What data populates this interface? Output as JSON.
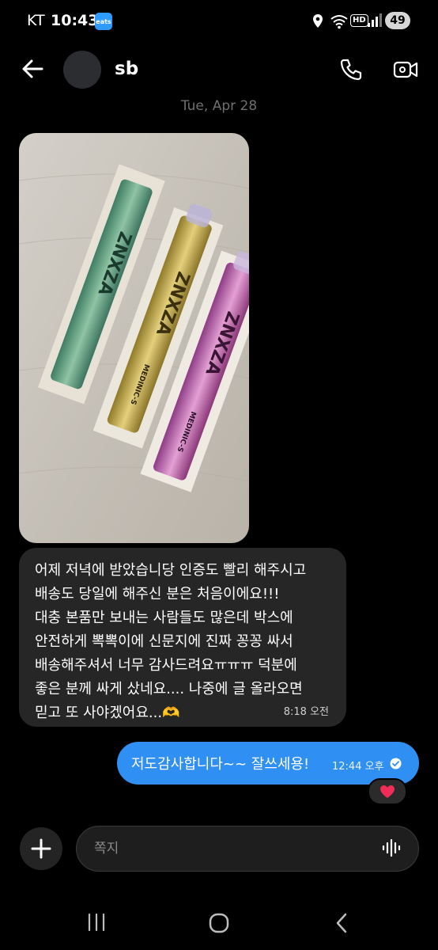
{
  "status_bar": {
    "carrier": "KT",
    "time": "10:43",
    "app_badge": "eats",
    "hd_label": "HD",
    "battery": "49"
  },
  "header": {
    "contact_name": "sb"
  },
  "date_separator": "Tue, Apr 28",
  "messages": {
    "received": {
      "lines": [
        "어제 저녁에 받았습니당 인증도 빨리 해주시고",
        "배송도 당일에 해주신 분은 처음이에요!!!",
        "대충 본품만 보내는 사람들도 많은데 박스에",
        "안전하게 뽁뽁이에 신문지에 진짜 꽁꽁 싸서",
        "배송해주셔서 너무 감사드려요ㅠㅠㅠ 덕분에",
        "좋은 분께 싸게 샀네요.... 나중에 글 올라오면",
        "믿고 또 사야겠어요...🫶"
      ],
      "time": "8:18 오전"
    },
    "sent": {
      "text": "저도감사합니다~~ 잘쓰세용!",
      "time": "12:44 오후"
    },
    "reaction": "❤️"
  },
  "photo": {
    "product_brand": "ZNXZA",
    "product_label": "MEDINIC-S",
    "colors": {
      "wood": "#c9c4ba",
      "teal": "#5f9b80",
      "gold": "#c4a744",
      "pink": "#c05aa0"
    }
  },
  "composer": {
    "placeholder": "쪽지"
  },
  "colors": {
    "background": "#000000",
    "received_bubble": "#262626",
    "sent_bubble": "#2f8ff2",
    "date_text": "#6f6f72"
  },
  "icons": [
    "back-arrow-icon",
    "phone-icon",
    "video-camera-icon",
    "plus-icon",
    "voice-wave-icon",
    "read-check-icon",
    "heart-icon"
  ]
}
